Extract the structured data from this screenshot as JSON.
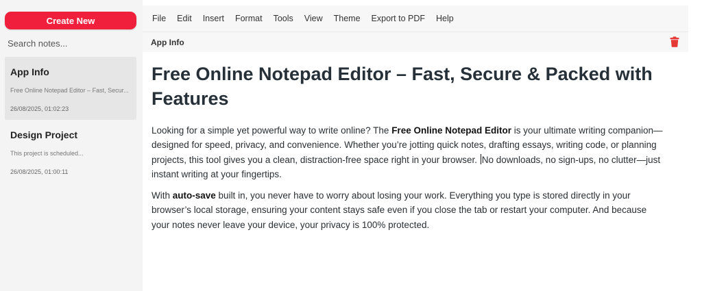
{
  "sidebar": {
    "create_label": "Create New",
    "search_placeholder": "Search notes...",
    "notes": [
      {
        "title": "App Info",
        "preview": "Free Online Notepad Editor – Fast, Secur...",
        "date": "26/08/2025, 01:02:23",
        "active": true
      },
      {
        "title": "Design Project",
        "preview": "This project is scheduled...",
        "date": "26/08/2025, 01:00:11",
        "active": false
      }
    ]
  },
  "menu": {
    "items": [
      "File",
      "Edit",
      "Insert",
      "Format",
      "Tools",
      "View",
      "Theme",
      "Export to PDF",
      "Help"
    ]
  },
  "document": {
    "name": "App Info",
    "delete_icon": "trash-icon",
    "heading": "Free Online Notepad Editor – Fast, Secure & Packed with Features",
    "p1_a": "Looking for a simple yet powerful way to write online? The ",
    "p1_bold": "Free Online Notepad Editor",
    "p1_b": " is your ultimate writing companion—designed for speed, privacy, and convenience. Whether you’re jotting quick notes, drafting essays, writing code, or planning projects, this tool gives you a clean, distraction-free space right in your browser.",
    "p1_c": "No downloads, no sign-ups, no clutter—just instant writing at your fingertips.",
    "p2_a": "With ",
    "p2_bold": "auto-save",
    "p2_b": " built in, you never have to worry about losing your work. Everything you type is stored directly in your browser’s local storage, ensuring your content stays safe even if you close the tab or restart your computer. And because your notes never leave your device, your privacy is 100% protected."
  },
  "colors": {
    "accent": "#f0203c",
    "trash": "#e53935",
    "sidebar_bg": "#f4f4f4",
    "active_note_bg": "#e6e6e6"
  }
}
